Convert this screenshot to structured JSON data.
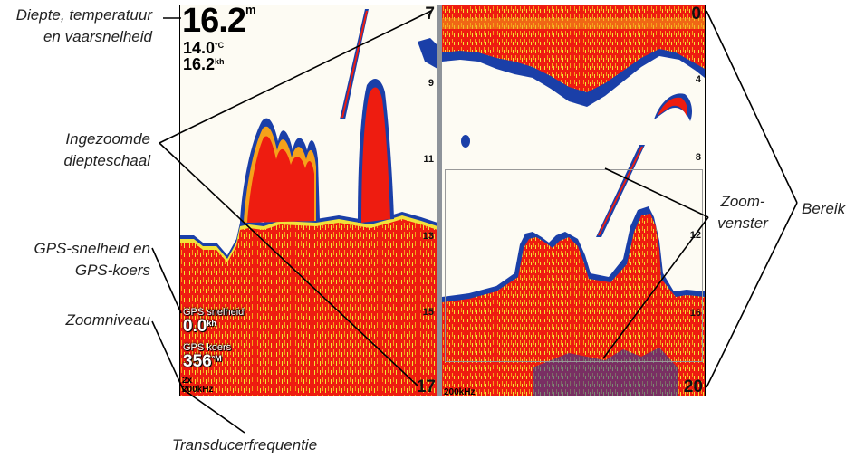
{
  "callouts": {
    "depth_temp_speed": [
      "Diepte, temperatuur",
      "en vaarsnelheid"
    ],
    "zoomed_depth_scale": [
      "Ingezoomde",
      "diepteschaal"
    ],
    "gps_speed_course": [
      "GPS-snelheid en",
      "GPS-koers"
    ],
    "zoom_level": "Zoomniveau",
    "transducer_frequency": "Transducerfrequentie",
    "zoom_window": [
      "Zoom-",
      "venster"
    ],
    "range": "Bereik"
  },
  "left_panel": {
    "depth_value": "16.2",
    "depth_unit": "m",
    "temperature_value": "14.0",
    "temperature_unit": "°C",
    "speed_value": "16.2",
    "speed_unit": "kh",
    "scale_top": "7",
    "scale_labels": [
      "9",
      "11",
      "13",
      "15"
    ],
    "scale_bottom": "17",
    "gps_speed_label": "GPS snelheid",
    "gps_speed_value": "0.0",
    "gps_speed_unit": "kh",
    "gps_course_label": "GPS koers",
    "gps_course_value": "356",
    "gps_course_unit": "°M",
    "zoom_level": "2x",
    "frequency": "200kHz"
  },
  "right_panel": {
    "scale_top": "0",
    "scale_labels": [
      "4",
      "8",
      "12",
      "16"
    ],
    "scale_bottom": "20",
    "frequency": "200kHz"
  },
  "colors": {
    "sonar_red": "#ee1c10",
    "sonar_orange": "#f5a21a",
    "sonar_yellow": "#f2e23a",
    "sonar_blue": "#1a3fa8",
    "sonar_background": "#fdfbf3"
  }
}
